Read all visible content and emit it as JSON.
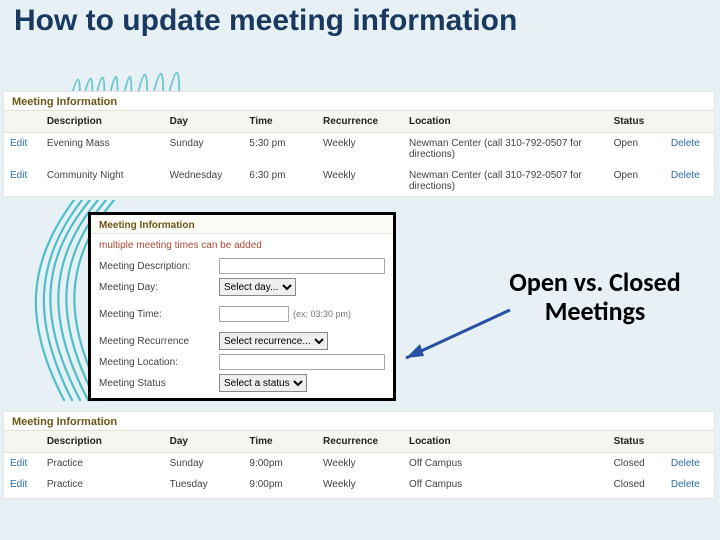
{
  "page": {
    "title": "How to update meeting information",
    "callout": "Open vs. Closed Meetings"
  },
  "tableA": {
    "section": "Meeting Information",
    "cols": [
      "Description",
      "Day",
      "Time",
      "Recurrence",
      "Location",
      "Status"
    ],
    "rows": [
      {
        "edit": "Edit",
        "desc": "Evening Mass",
        "day": "Sunday",
        "time": "5:30 pm",
        "rec": "Weekly",
        "loc": "Newman Center (call 310-792-0507 for directions)",
        "status": "Open",
        "del": "Delete"
      },
      {
        "edit": "Edit",
        "desc": "Community Night",
        "day": "Wednesday",
        "time": "6:30 pm",
        "rec": "Weekly",
        "loc": "Newman Center (call 310-792-0507 for directions)",
        "status": "Open",
        "del": "Delete"
      }
    ]
  },
  "tableB": {
    "section": "Meeting Information",
    "cols": [
      "Description",
      "Day",
      "Time",
      "Recurrence",
      "Location",
      "Status"
    ],
    "rows": [
      {
        "edit": "Edit",
        "desc": "Practice",
        "day": "Sunday",
        "time": "9:00pm",
        "rec": "Weekly",
        "loc": "Off Campus",
        "status": "Closed",
        "del": "Delete"
      },
      {
        "edit": "Edit",
        "desc": "Practice",
        "day": "Tuesday",
        "time": "9:00pm",
        "rec": "Weekly",
        "loc": "Off Campus",
        "status": "Closed",
        "del": "Delete"
      }
    ]
  },
  "form": {
    "section": "Meeting Information",
    "note": "multiple meeting times can be added",
    "labels": {
      "desc": "Meeting Description:",
      "day": "Meeting Day:",
      "time": "Meeting Time:",
      "rec": "Meeting Recurrence",
      "loc": "Meeting Location:",
      "status": "Meeting Status"
    },
    "placeholders": {
      "day": "Select day... ",
      "timehint": "(ex: 03:30 pm)",
      "rec": "Select recurrence... ",
      "status": "Select a status "
    }
  }
}
